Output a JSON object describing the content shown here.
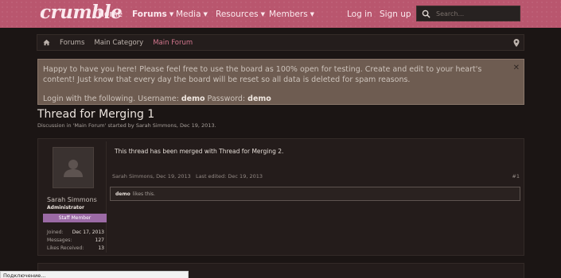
{
  "header": {
    "logo": "crumble",
    "nav": [
      {
        "label": "Home"
      },
      {
        "label": "Forums"
      },
      {
        "label": "Media"
      },
      {
        "label": "Resources"
      },
      {
        "label": "Members"
      }
    ],
    "login": "Log in",
    "signup": "Sign up",
    "search_placeholder": "Search..."
  },
  "breadcrumb": [
    "Forums",
    "Main Category",
    "Main Forum"
  ],
  "notice": {
    "text": "Happy to have you here! Please feel free to use the board as 100% open for testing. Create and edit to your heart's content! Just know that every day the board will be reset so all data is deleted for spam reasons.",
    "login_prefix": "Login with the following. Username:",
    "username": "demo",
    "password_prefix": "Password:",
    "password": "demo"
  },
  "thread": {
    "title": "Thread for Merging 1",
    "subtitle": "Discussion in 'Main Forum' started by Sarah Simmons, Dec 19, 2013."
  },
  "post": {
    "user": {
      "name": "Sarah Simmons",
      "role": "Administrator",
      "badge": "Staff Member",
      "stats": [
        {
          "label": "Joined:",
          "value": "Dec 17, 2013"
        },
        {
          "label": "Messages:",
          "value": "127"
        },
        {
          "label": "Likes Received:",
          "value": "13"
        }
      ]
    },
    "message": "This thread has been merged with Thread for Merging 2.",
    "meta": "Sarah Simmons, Dec 19, 2013   Last edited: Dec 19, 2013",
    "number": "#1",
    "likes_user": "demo",
    "likes_text": "likes this."
  },
  "status_bar": "Подключение..."
}
